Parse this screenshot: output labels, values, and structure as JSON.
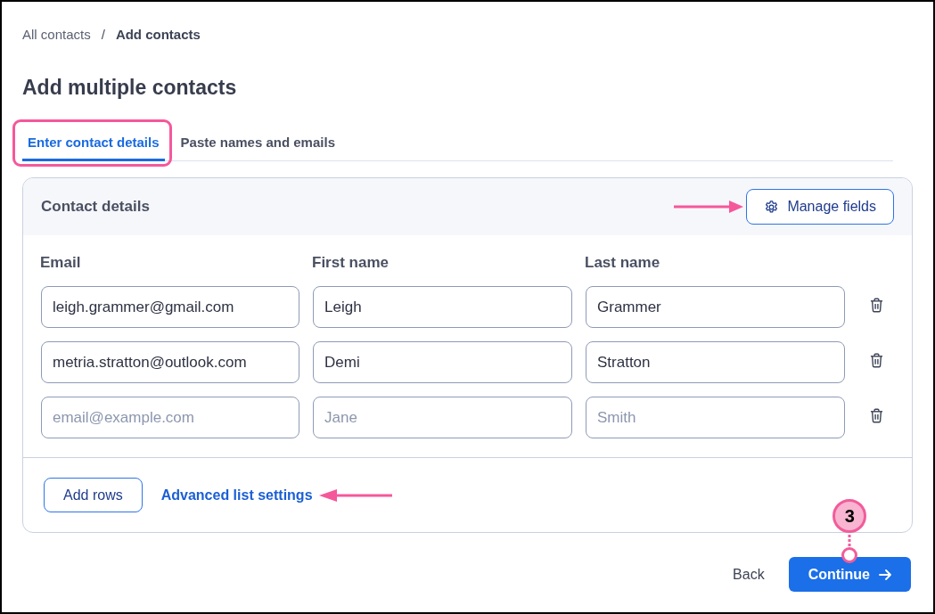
{
  "breadcrumb": {
    "separator": "/",
    "items": [
      {
        "label": "All contacts",
        "current": false
      },
      {
        "label": "Add contacts",
        "current": true
      }
    ]
  },
  "title": "Add multiple contacts",
  "tabs": [
    {
      "label": "Enter contact details",
      "selected": true,
      "highlighted": true
    },
    {
      "label": "Paste names and emails",
      "selected": false,
      "highlighted": false
    }
  ],
  "contact_details": {
    "title": "Contact details",
    "manage_fields": {
      "label": "Manage fields",
      "pointed": true
    },
    "columns": [
      "Email",
      "First name",
      "Last name"
    ],
    "rows": [
      {
        "cells": [
          {
            "value": "leigh.grammer@gmail.com"
          },
          {
            "value": "Leigh"
          },
          {
            "value": "Grammer"
          }
        ]
      },
      {
        "cells": [
          {
            "value": "metria.stratton@outlook.com"
          },
          {
            "value": "Demi"
          },
          {
            "value": "Stratton"
          }
        ]
      },
      {
        "cells": [
          {
            "placeholder": "email@example.com"
          },
          {
            "placeholder": "Jane"
          },
          {
            "placeholder": "Smith"
          }
        ]
      }
    ],
    "add_rows": "Add rows",
    "advanced_settings": {
      "label": "Advanced list settings",
      "pointed": true
    }
  },
  "footer": {
    "back": "Back",
    "continue": {
      "label": "Continue",
      "step": "3"
    }
  }
}
